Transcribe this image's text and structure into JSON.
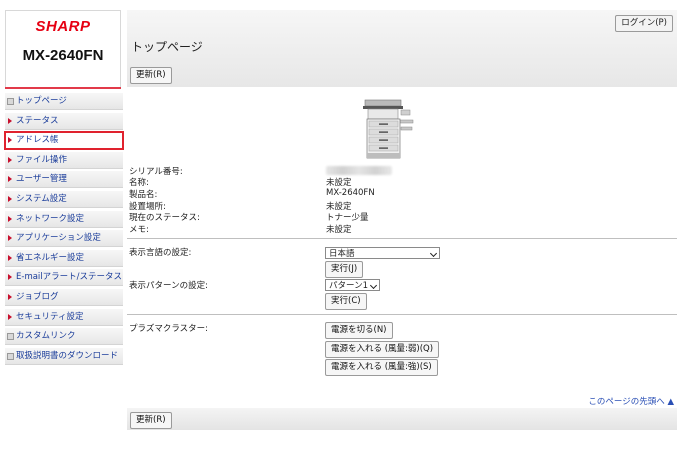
{
  "brand": {
    "logo": "SHARP",
    "model": "MX-2640FN"
  },
  "header": {
    "login_label": "ログイン(P)",
    "page_title": "トップページ",
    "refresh_label": "更新(R)"
  },
  "sidebar": {
    "items": [
      {
        "label": "トップページ",
        "icon": "square-icon"
      },
      {
        "label": "ステータス",
        "icon": "arrow-right-icon"
      },
      {
        "label": "アドレス帳",
        "icon": "arrow-right-icon"
      },
      {
        "label": "ファイル操作",
        "icon": "arrow-right-icon"
      },
      {
        "label": "ユーザー管理",
        "icon": "arrow-right-icon"
      },
      {
        "label": "システム設定",
        "icon": "arrow-right-icon"
      },
      {
        "label": "ネットワーク設定",
        "icon": "arrow-right-icon"
      },
      {
        "label": "アプリケーション設定",
        "icon": "arrow-right-icon"
      },
      {
        "label": "省エネルギー設定",
        "icon": "arrow-right-icon"
      },
      {
        "label": "E-mailアラート/ステータス",
        "icon": "arrow-right-icon"
      },
      {
        "label": "ジョブログ",
        "icon": "arrow-right-icon"
      },
      {
        "label": "セキュリティ設定",
        "icon": "arrow-right-icon"
      },
      {
        "label": "カスタムリンク",
        "icon": "square-icon"
      },
      {
        "label": "取扱説明書のダウンロード",
        "icon": "square-icon"
      }
    ],
    "selected_index": 2,
    "accent_color": "#e0222e"
  },
  "device": {
    "serial_label": "シリアル番号:",
    "name_label": "名称:",
    "name_value": "未設定",
    "product_label": "製品名:",
    "product_value": "MX-2640FN",
    "location_label": "設置場所:",
    "location_value": "未設定",
    "status_label": "現在のステータス:",
    "status_value": "トナー少量",
    "memo_label": "メモ:",
    "memo_value": "未設定"
  },
  "settings": {
    "language_label": "表示言語の設定:",
    "language_value": "日本語",
    "exec_j_label": "実行(J)",
    "pattern_label": "表示パターンの設定:",
    "pattern_value": "パターン1",
    "exec_c_label": "実行(C)"
  },
  "plasma": {
    "label": "プラズマクラスター:",
    "off_label": "電源を切る(N)",
    "weak_label": "電源を入れる (風量:弱)(Q)",
    "strong_label": "電源を入れる (風量:強)(S)"
  },
  "footer": {
    "top_link": "このページの先頭へ ▲",
    "refresh_label": "更新(R)"
  }
}
